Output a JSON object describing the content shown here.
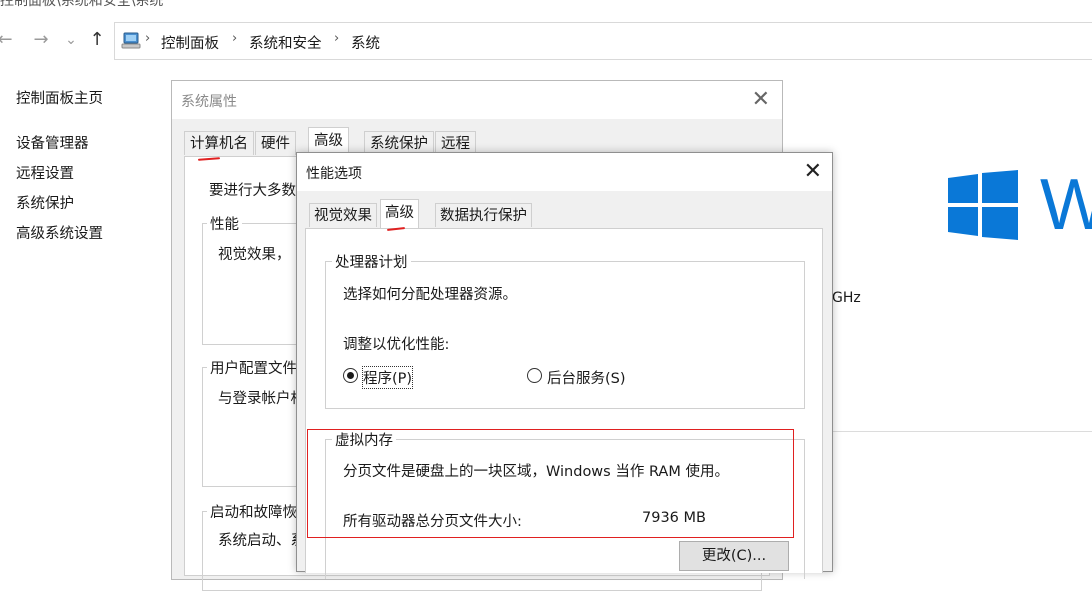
{
  "window": {
    "title": "控制面板\\系统和安全\\系统"
  },
  "nav": {
    "back_icon": "←",
    "forward_icon": "→",
    "dropdown_icon": "⌄",
    "up_icon": "↑",
    "breadcrumb": [
      "控制面板",
      "系统和安全",
      "系统"
    ],
    "separator": "›"
  },
  "sidebar": {
    "home": "控制面板主页",
    "items": [
      {
        "label": "设备管理器"
      },
      {
        "label": "远程设置"
      },
      {
        "label": "系统保护"
      },
      {
        "label": "高级系统设置"
      }
    ]
  },
  "background": {
    "cpu_fragment": "GHz",
    "brand_letter": "W",
    "brand_color": "#0a78d7"
  },
  "system_properties": {
    "title": "系统属性",
    "close_icon": "✕",
    "tabs": [
      {
        "label": "计算机名"
      },
      {
        "label": "硬件"
      },
      {
        "label": "高级",
        "active": true
      },
      {
        "label": "系统保护"
      },
      {
        "label": "远程"
      }
    ],
    "intro": "要进行大多数",
    "performance": {
      "title": "性能",
      "text": "视觉效果，"
    },
    "user_profiles": {
      "title": "用户配置文件",
      "text": "与登录帐户相"
    },
    "startup": {
      "title": "启动和故障恢复",
      "text": "系统启动、系"
    }
  },
  "performance_options": {
    "title": "性能选项",
    "close_icon": "✕",
    "tabs": [
      {
        "label": "视觉效果"
      },
      {
        "label": "高级",
        "active": true
      },
      {
        "label": "数据执行保护"
      }
    ],
    "processor": {
      "title": "处理器计划",
      "description": "选择如何分配处理器资源。",
      "adjust_label": "调整以优化性能:",
      "option_programs": "程序(P)",
      "option_services": "后台服务(S)",
      "selected": "programs"
    },
    "virtual_memory": {
      "title": "虚拟内存",
      "description": "分页文件是硬盘上的一块区域，Windows 当作 RAM 使用。",
      "total_label": "所有驱动器总分页文件大小:",
      "total_value": "7936 MB",
      "change_button": "更改(C)..."
    }
  },
  "annotation_color": "#e02020"
}
